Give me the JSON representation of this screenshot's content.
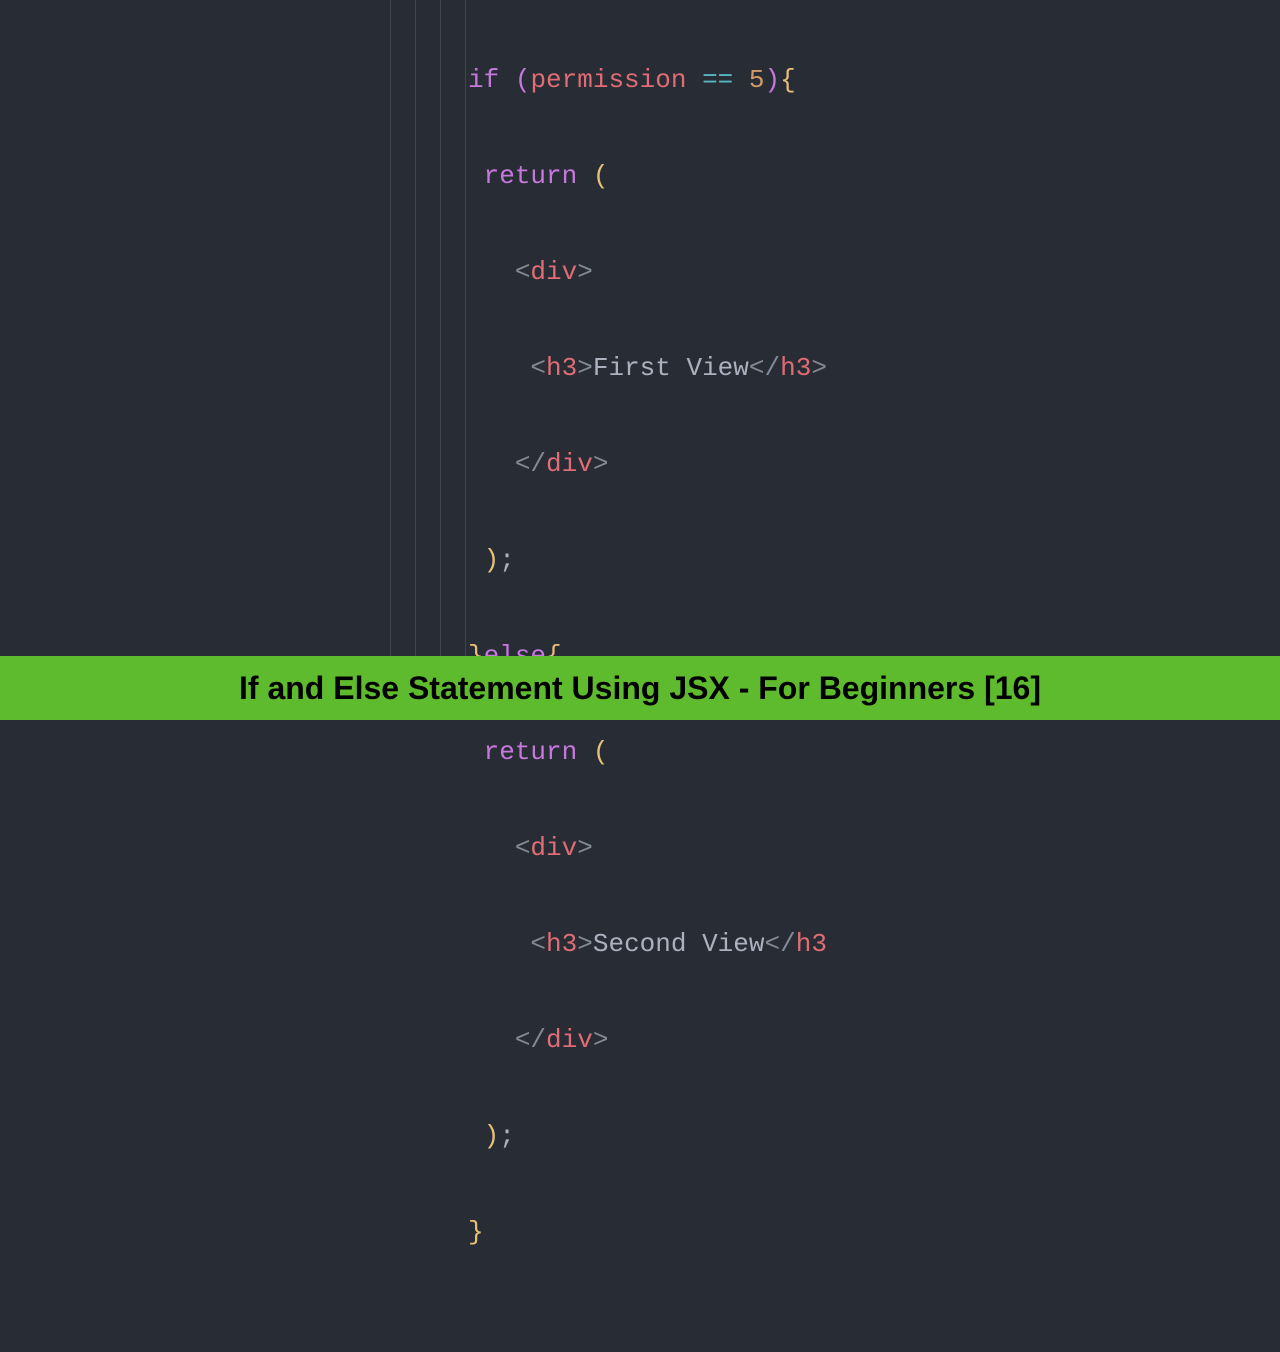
{
  "editor": {
    "code": {
      "l1": {
        "if": "if",
        "op_space": " ",
        "p1": "(",
        "var": "permission",
        "sp1": " ",
        "eq": "==",
        "sp2": " ",
        "num": "5",
        "p2": ")",
        "brace": "{"
      },
      "l2": {
        "indent": " ",
        "return": "return",
        "sp": " ",
        "paren": "("
      },
      "l3": {
        "indent": "   ",
        "lt": "<",
        "tag": "div",
        "gt": ">"
      },
      "l4": {
        "indent": "    ",
        "lt1": "<",
        "tag1": "h3",
        "gt1": ">",
        "text": "First View",
        "lt2": "</",
        "tag2": "h3",
        "gt2": ">"
      },
      "l5": {
        "indent": "   ",
        "lt": "</",
        "tag": "div",
        "gt": ">"
      },
      "l6": {
        "indent": " ",
        "paren": ")",
        "semi": ";"
      },
      "l7": {
        "brace1": "}",
        "else": "else",
        "brace2": "{"
      },
      "l8": {
        "indent": " ",
        "return": "return",
        "sp": " ",
        "paren": "("
      },
      "l9": {
        "indent": "   ",
        "lt": "<",
        "tag": "div",
        "gt": ">"
      },
      "l10": {
        "indent": "    ",
        "lt1": "<",
        "tag1": "h3",
        "gt1": ">",
        "text": "Second View",
        "lt2": "</",
        "tag2": "h3",
        "gt2_partial": ""
      },
      "l11": {
        "indent": "   ",
        "lt": "</",
        "tag": "div",
        "gt": ">"
      },
      "l12": {
        "indent": " ",
        "paren": ")",
        "semi": ";"
      },
      "l13": {
        "brace": "}"
      }
    }
  },
  "banner": {
    "title": "If and Else Statement Using JSX - For Beginners [16]"
  },
  "colors": {
    "background": "#282c34",
    "banner_bg": "#5fbb2e",
    "keyword": "#c678dd",
    "variable": "#e06c75",
    "operator": "#56b6c2",
    "number": "#d19a66",
    "brace": "#e5c07b",
    "text": "#abb2bf"
  }
}
